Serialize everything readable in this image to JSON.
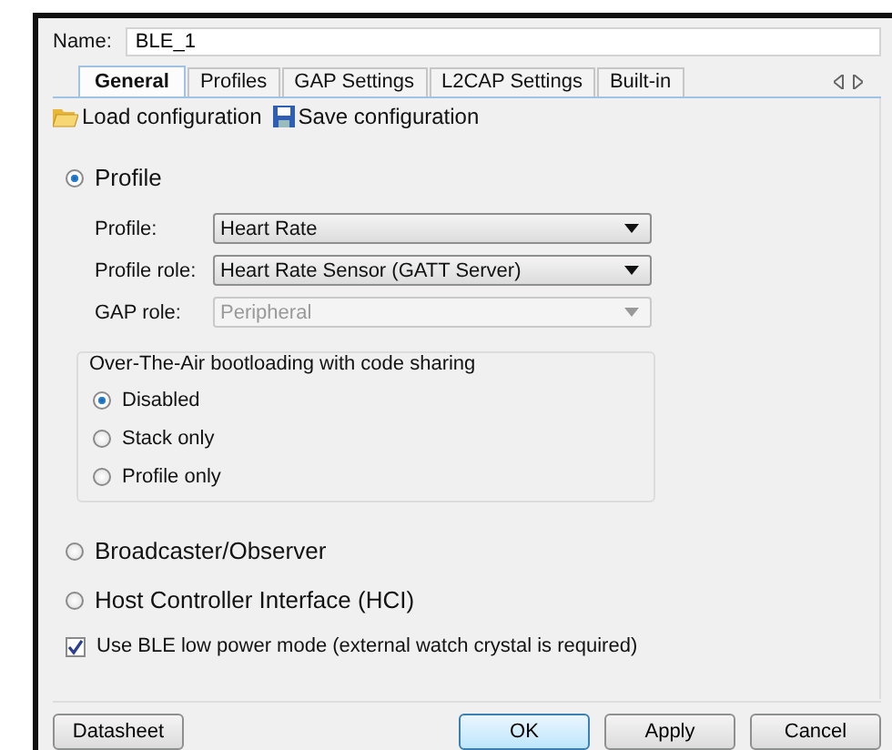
{
  "name_field": {
    "label": "Name:",
    "value": "BLE_1"
  },
  "tabs": [
    {
      "label": "General",
      "selected": true
    },
    {
      "label": "Profiles",
      "selected": false
    },
    {
      "label": "GAP Settings",
      "selected": false
    },
    {
      "label": "L2CAP Settings",
      "selected": false
    },
    {
      "label": "Built-in",
      "selected": false
    }
  ],
  "toolbar": [
    {
      "label": "Load configuration",
      "kind": "load"
    },
    {
      "label": "Save configuration",
      "kind": "save"
    }
  ],
  "modes": [
    {
      "label": "Profile",
      "selected": true
    },
    {
      "label": "Broadcaster/Observer",
      "selected": false
    },
    {
      "label": "Host Controller Interface (HCI)",
      "selected": false
    }
  ],
  "profile_fields": [
    {
      "label": "Profile:",
      "value": "Heart Rate",
      "disabled": false
    },
    {
      "label": "Profile role:",
      "value": "Heart Rate Sensor (GATT Server)",
      "disabled": false
    },
    {
      "label": "GAP role:",
      "value": "Peripheral",
      "disabled": true
    }
  ],
  "ota_group": {
    "title": "Over-The-Air bootloading with code sharing",
    "options": [
      {
        "label": "Disabled",
        "selected": true
      },
      {
        "label": "Stack only",
        "selected": false
      },
      {
        "label": "Profile only",
        "selected": false
      }
    ]
  },
  "low_power": {
    "label": "Use BLE low power mode (external watch crystal is required)",
    "checked": true
  },
  "left_buttons": [
    {
      "label": "Datasheet",
      "default": false
    }
  ],
  "buttons": [
    {
      "label": "OK",
      "default": true
    },
    {
      "label": "Apply",
      "default": false
    },
    {
      "label": "Cancel",
      "default": false
    }
  ]
}
